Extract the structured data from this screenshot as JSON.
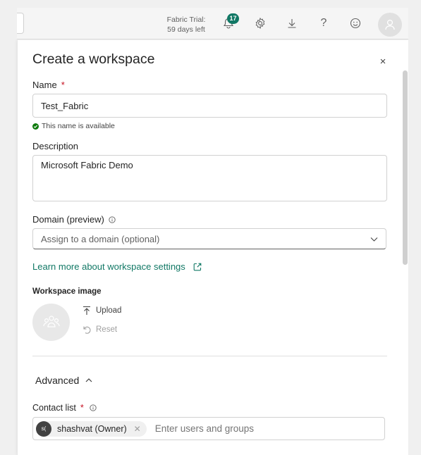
{
  "topbar": {
    "trial_line1": "Fabric Trial:",
    "trial_line2": "59 days left",
    "notification_count": "17",
    "icons": [
      "bell-icon",
      "gear-icon",
      "download-icon",
      "help-icon",
      "feedback-icon",
      "account-icon"
    ]
  },
  "dialog": {
    "title": "Create a workspace",
    "close_symbol": "×"
  },
  "name": {
    "label": "Name",
    "required_mark": "*",
    "value": "Test_Fabric",
    "availability": "This name is available"
  },
  "description": {
    "label": "Description",
    "value": "Microsoft Fabric Demo"
  },
  "domain": {
    "label": "Domain (preview)",
    "placeholder": "Assign to a domain (optional)"
  },
  "learn_more": "Learn more about workspace settings",
  "workspace_image": {
    "label": "Workspace image",
    "upload": "Upload",
    "reset": "Reset"
  },
  "advanced": {
    "label": "Advanced"
  },
  "contact_list": {
    "label": "Contact list",
    "required_mark": "*",
    "chip_initials": "s(",
    "chip_name": "shashvat (Owner)",
    "placeholder": "Enter users and groups"
  },
  "colors": {
    "accent": "#117865",
    "required": "#c50f1f",
    "success": "#0e7a0d"
  }
}
